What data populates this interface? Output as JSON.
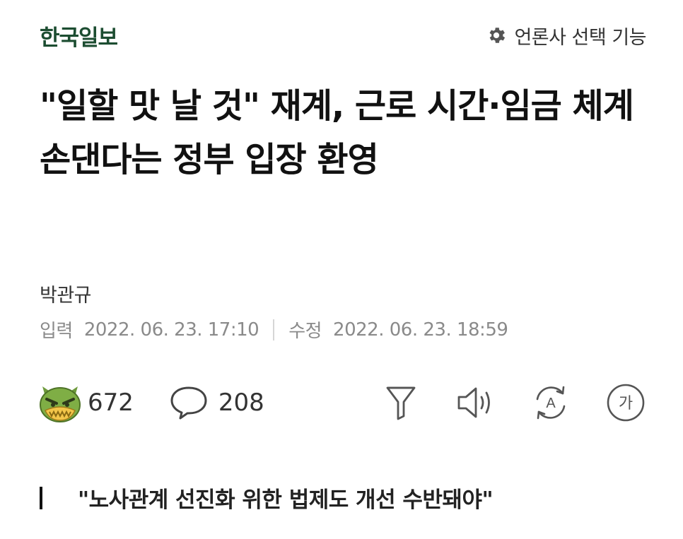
{
  "header": {
    "press_name": "한국일보",
    "press_select_label": "언론사 선택 기능",
    "press_select_icon": "gear-icon"
  },
  "article": {
    "headline": "\"일할 맛 날 것\" 재계, 근로 시간·임금 체계 손댄다는 정부 입장 환영",
    "reporter": "박관규",
    "input_label": "입력",
    "input_time": "2022. 06. 23. 17:10",
    "modified_label": "수정",
    "modified_time": "2022. 06. 23. 18:59",
    "subheading": "\"노사관계 선진화 위한 법제도 개선 수반돼야\""
  },
  "actions": {
    "reaction_icon": "angry-reaction-icon",
    "reaction_count": "672",
    "comment_icon": "comment-bubble-icon",
    "comment_count": "208",
    "tools": [
      "summary-filter-icon",
      "speaker-icon",
      "translate-icon",
      "font-size-icon"
    ],
    "font_size_glyph": "가",
    "translate_glyph": "A"
  },
  "colors": {
    "brand": "#1c4d31",
    "meta_gray": "#8a8a8a",
    "icon_gray": "#555555"
  }
}
